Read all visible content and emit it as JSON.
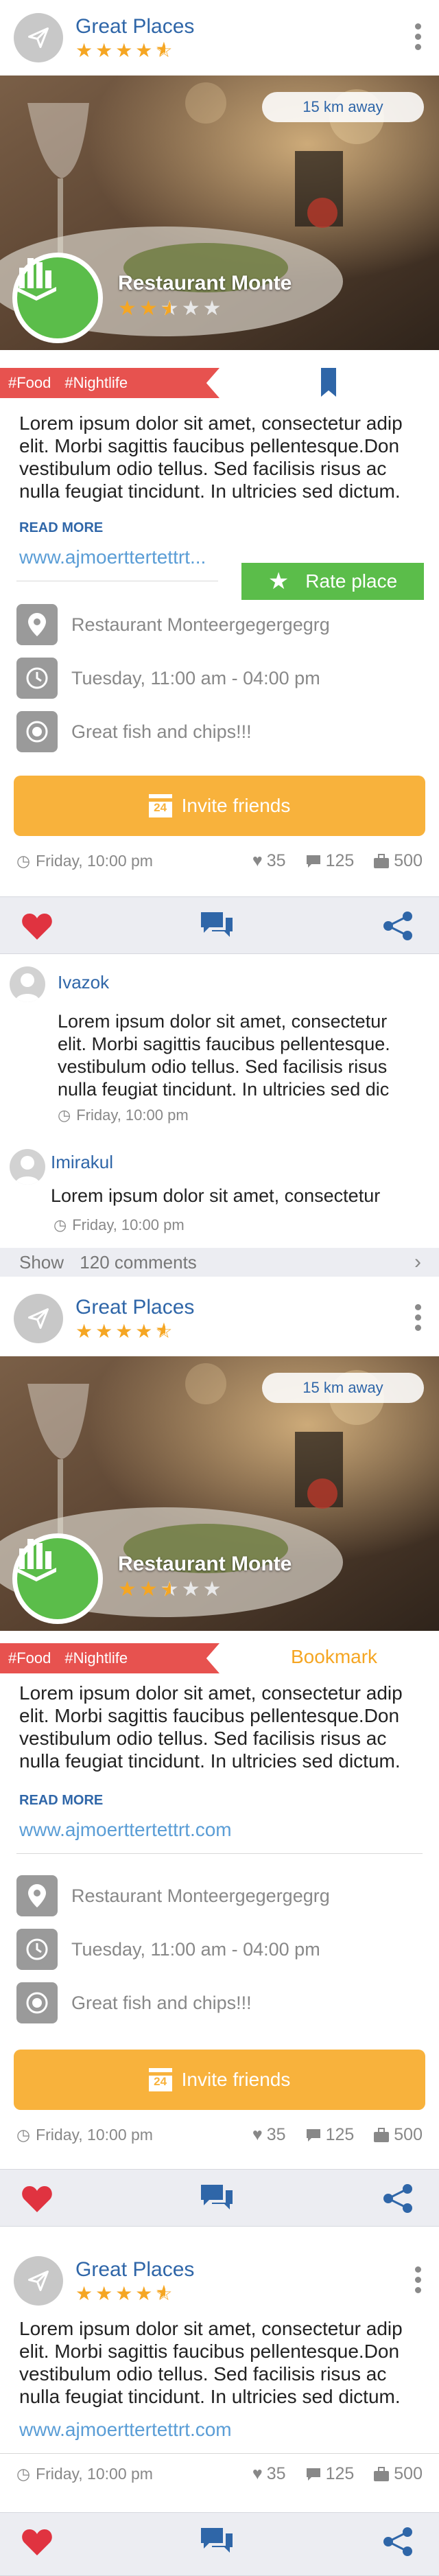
{
  "cards": [
    {
      "place_title": "Great Places",
      "place_rating": 4.5,
      "distance": "15 km away",
      "restaurant_name": "Restaurant Monte",
      "restaurant_rating": 2.5,
      "tags": [
        "#Food",
        "#Nightlife"
      ],
      "description": "Lorem ipsum dolor sit amet, consectetur adip elit. Morbi sagittis faucibus pellentesque.Don vestibulum odio tellus. Sed facilisis risus ac nulla feugiat tincidunt. In ultricies sed dictum.",
      "read_more": "READ MORE",
      "link": "www.ajmoerttertettrt...",
      "rate_label": "Rate place",
      "address": "Restaurant Monteergegergegrg",
      "hours": "Tuesday, 11:00 am - 04:00 pm",
      "note": "Great fish and chips!!!",
      "invite_label": "Invite friends",
      "calendar_day": "24",
      "event_time": "Friday, 10:00 pm",
      "likes": "35",
      "comments": "125",
      "attending": "500"
    },
    {
      "place_title": "Great Places",
      "place_rating": 4.5,
      "distance": "15 km away",
      "restaurant_name": "Restaurant Monte",
      "restaurant_rating": 2.5,
      "tags": [
        "#Food",
        "#Nightlife"
      ],
      "bookmark_label": "Bookmark",
      "description": "Lorem ipsum dolor sit amet, consectetur adip elit. Morbi sagittis faucibus pellentesque.Don vestibulum odio tellus. Sed facilisis risus ac nulla feugiat tincidunt. In ultricies sed dictum.",
      "read_more": "READ MORE",
      "link": "www.ajmoerttertettrt.com",
      "address": "Restaurant Monteergegergegrg",
      "hours": "Tuesday, 11:00 am - 04:00 pm",
      "note": "Great fish and chips!!!",
      "invite_label": "Invite friends",
      "calendar_day": "24",
      "event_time": "Friday, 10:00 pm",
      "likes": "35",
      "comments": "125",
      "attending": "500"
    },
    {
      "place_title": "Great Places",
      "place_rating": 4.5,
      "description": "Lorem ipsum dolor sit amet, consectetur adip elit. Morbi sagittis faucibus pellentesque.Don vestibulum odio tellus. Sed facilisis risus ac nulla feugiat tincidunt. In ultricies sed dictum.",
      "link": "www.ajmoerttertettrt.com",
      "event_time": "Friday, 10:00 pm",
      "likes": "35",
      "comments": "125",
      "attending": "500"
    }
  ],
  "comments": [
    {
      "author": "Ivazok",
      "text": "Lorem ipsum dolor sit amet, consectetur elit. Morbi sagittis faucibus pellentesque. vestibulum odio tellus. Sed facilisis risus nulla feugiat tincidunt. In ultricies sed dic",
      "time": "Friday, 10:00 pm"
    },
    {
      "author": "Imirakul",
      "text": "Lorem ipsum dolor sit amet, consectetur",
      "time": "Friday, 10:00 pm"
    }
  ],
  "show_comments": {
    "label": "Show",
    "count_text": "120 comments"
  },
  "icons": {
    "header_logo": "paper-plane-icon",
    "menu": "more-vertical-icon",
    "badge": "city-buildings-icon",
    "bookmark": "bookmark-ribbon-icon",
    "rate": "star-icon",
    "address": "map-pin-icon",
    "hours": "clock-icon",
    "note": "target-icon",
    "invite": "calendar-icon",
    "likes": "heart-icon",
    "comments": "chat-bubble-icon",
    "attending": "briefcase-icon",
    "bar_like": "heart-icon",
    "bar_comment": "chat-bubble-icon",
    "bar_share": "share-icon"
  },
  "colors": {
    "brand_blue": "#2f66a8",
    "link_blue": "#5a9dd6",
    "star_orange": "#f5a623",
    "tag_red": "#e7524f",
    "green": "#5bbd4a",
    "invite_orange": "#f8b23c",
    "heart_red": "#e03340",
    "bar_bg": "#ecedf2"
  }
}
